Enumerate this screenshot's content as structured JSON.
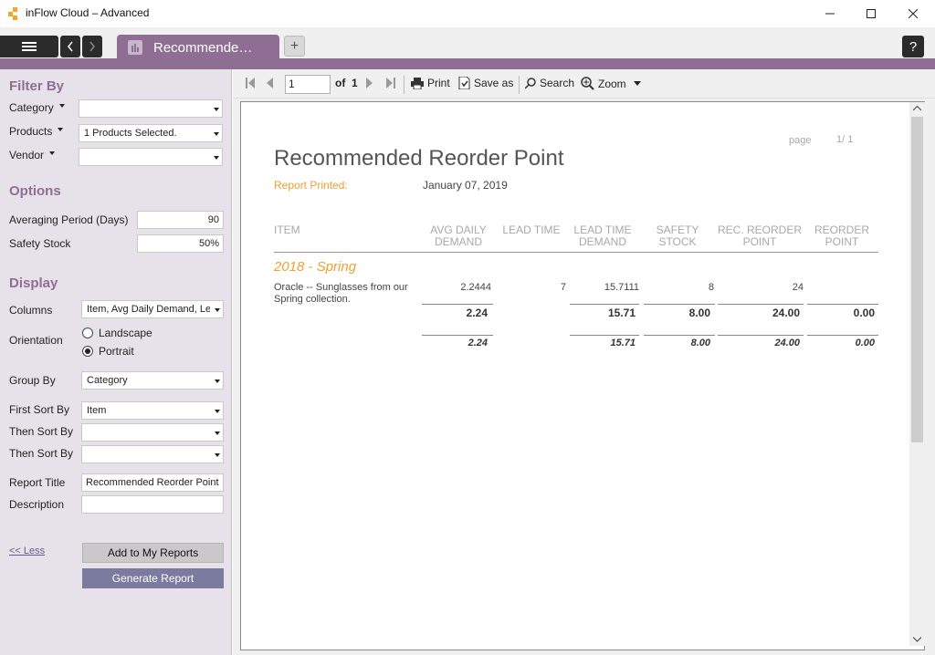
{
  "window": {
    "title": "inFlow Cloud – Advanced"
  },
  "tabs": {
    "active_label": "Recommende…",
    "new_tab": "+",
    "help": "?"
  },
  "sidebar": {
    "filter_by": {
      "title": "Filter By",
      "category_label": "Category",
      "category_value": "",
      "products_label": "Products",
      "products_value": "1 Products Selected.",
      "vendor_label": "Vendor",
      "vendor_value": ""
    },
    "options": {
      "title": "Options",
      "averaging_label": "Averaging Period (Days)",
      "averaging_value": "90",
      "safety_label": "Safety Stock",
      "safety_value": "50%"
    },
    "display": {
      "title": "Display",
      "columns_label": "Columns",
      "columns_value": "Item, Avg Daily Demand, Lead T",
      "orientation_label": "Orientation",
      "landscape": "Landscape",
      "portrait": "Portrait",
      "orientation_selected": "Portrait",
      "group_by_label": "Group By",
      "group_by_value": "Category",
      "first_sort_label": "First Sort By",
      "first_sort_value": "Item",
      "then_sort_label_1": "Then Sort By",
      "then_sort_value_1": "",
      "then_sort_label_2": "Then Sort By",
      "then_sort_value_2": "",
      "report_title_label": "Report Title",
      "report_title_value": "Recommended Reorder Point",
      "description_label": "Description",
      "description_value": ""
    },
    "less_link": "<< Less",
    "add_button": "Add to My Reports",
    "generate_button": "Generate Report"
  },
  "toolbar": {
    "page_value": "1",
    "of_label": "of",
    "total_pages": "1",
    "print": "Print",
    "save_as": "Save as",
    "search": "Search",
    "zoom": "Zoom"
  },
  "report": {
    "page_label": "page",
    "page_number": "1/ 1",
    "title": "Recommended Reorder Point",
    "printed_label": "Report Printed:",
    "printed_date": "January 07, 2019",
    "columns": {
      "item": "ITEM",
      "avg_daily_demand": "AVG DAILY\nDEMAND",
      "lead_time": "LEAD TIME",
      "lead_time_demand": "LEAD TIME\nDEMAND",
      "safety_stock": "SAFETY\nSTOCK",
      "rec_reorder_point": "REC. REORDER\nPOINT",
      "reorder_point": "REORDER\nPOINT"
    },
    "group": "2018 - Spring",
    "row": {
      "item": "Oracle -- Sunglasses from our Spring collection.",
      "avg_daily_demand": "2.2444",
      "lead_time": "7",
      "lead_time_demand": "15.7111",
      "safety_stock": "8",
      "rec_reorder_point": "24",
      "reorder_point": ""
    },
    "group_total": {
      "avg_daily_demand": "2.24",
      "lead_time_demand": "15.71",
      "safety_stock": "8.00",
      "rec_reorder_point": "24.00",
      "reorder_point": "0.00"
    },
    "grand_total": {
      "avg_daily_demand": "2.24",
      "lead_time_demand": "15.71",
      "safety_stock": "8.00",
      "rec_reorder_point": "24.00",
      "reorder_point": "0.00"
    }
  },
  "colors": {
    "accent": "#8e6f93",
    "orange": "#f0a030",
    "generate": "#7a7b9e"
  }
}
